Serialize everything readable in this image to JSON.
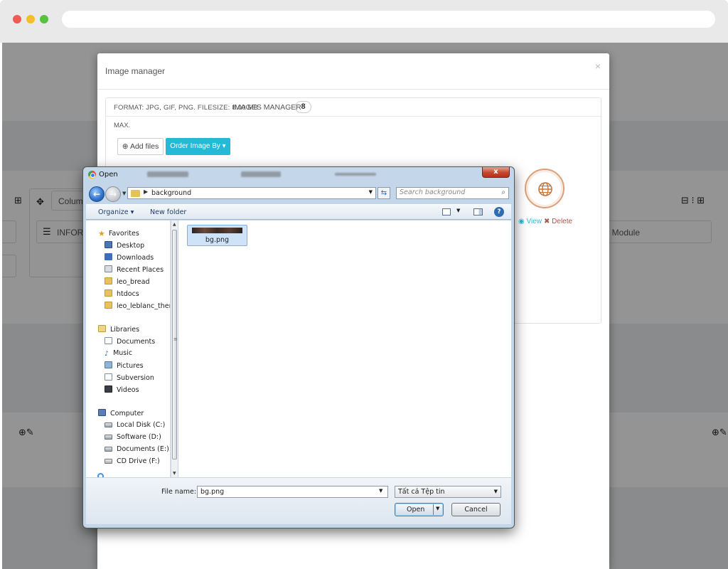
{
  "modal": {
    "title": "Image manager",
    "close": "×",
    "format_text": "FORMAT: JPG, GIF, PNG. FILESIZE: 8.00 MB",
    "images_manager_label": "IMAGES MANAGER",
    "images_count": "8",
    "max_text": "MAX.",
    "add_files_label": "Add files",
    "order_image_label": "Order Image By",
    "view_label": "View",
    "delete_label": "Delete"
  },
  "background_page": {
    "column_text": "Column",
    "info_text": "INFOR",
    "module_text": "s - Module"
  },
  "open_dialog": {
    "title": "Open",
    "close_glyph": "x",
    "address_path": "background",
    "search_placeholder": "Search background",
    "organize_label": "Organize",
    "new_folder_label": "New folder",
    "help_glyph": "?",
    "favorites_label": "Favorites",
    "favorites": [
      "Desktop",
      "Downloads",
      "Recent Places",
      "leo_bread",
      "htdocs",
      "leo_leblanc_them"
    ],
    "libraries_label": "Libraries",
    "libraries": [
      "Documents",
      "Music",
      "Pictures",
      "Subversion",
      "Videos"
    ],
    "computer_label": "Computer",
    "drives": [
      "Local Disk (C:)",
      "Software (D:)",
      "Documents (E:)",
      "CD Drive (F:)"
    ],
    "files": [
      {
        "name": "bg.png"
      }
    ],
    "file_name_label": "File name:",
    "file_name_value": "bg.png",
    "file_type_value": "Tất cả Tệp tin",
    "open_label": "Open",
    "cancel_label": "Cancel"
  },
  "colors": {
    "accent": "#25b9d7",
    "delete": "#a8584a",
    "globe": "#dba07a"
  }
}
